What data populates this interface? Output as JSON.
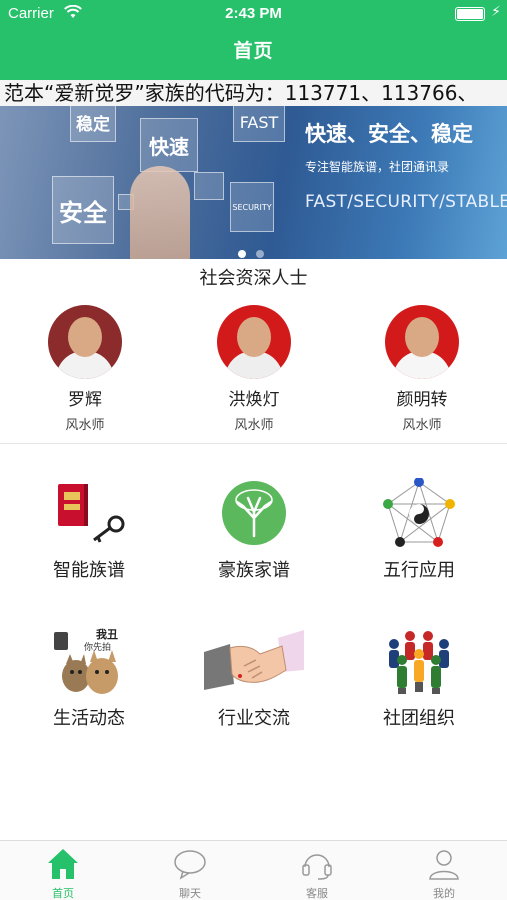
{
  "status_bar": {
    "carrier": "Carrier",
    "time": "2:43 PM"
  },
  "nav": {
    "title": "首页"
  },
  "marquee": {
    "text": "范本“爱新觉罗”家族的代码为：113771、113766、"
  },
  "banner": {
    "tiles": [
      "稳定",
      "快速",
      "FAST",
      "安全",
      "SECURITY"
    ],
    "headline": "快速、安全、稳定",
    "subline": "专注智能族谱，社团通讯录",
    "english": "FAST/SECURITY/STABLE",
    "slide_count": 2,
    "active_slide": 1
  },
  "section": {
    "title": "社会资深人士"
  },
  "people": [
    {
      "name": "罗辉",
      "role": "风水师",
      "bg": "#8b2b2b"
    },
    {
      "name": "洪焕灯",
      "role": "风水师",
      "bg": "#d21a1a"
    },
    {
      "name": "颜明转",
      "role": "风水师",
      "bg": "#d21a1a"
    }
  ],
  "features": [
    {
      "label": "智能族谱",
      "icon": "book-key-icon"
    },
    {
      "label": "豪族家谱",
      "icon": "tree-icon"
    },
    {
      "label": "五行应用",
      "icon": "wuxing-icon"
    },
    {
      "label": "生活动态",
      "icon": "cats-selfie-icon",
      "caption_top": "我丑",
      "caption_bottom": "你先拍"
    },
    {
      "label": "行业交流",
      "icon": "handshake-icon"
    },
    {
      "label": "社团组织",
      "icon": "group-people-icon"
    }
  ],
  "tabs": [
    {
      "label": "首页",
      "icon": "home-icon",
      "active": true
    },
    {
      "label": "聊天",
      "icon": "chat-icon",
      "active": false
    },
    {
      "label": "客服",
      "icon": "headset-icon",
      "active": false
    },
    {
      "label": "我的",
      "icon": "user-icon",
      "active": false
    }
  ],
  "colors": {
    "primary": "#27c16b",
    "tab_inactive": "#888888"
  }
}
